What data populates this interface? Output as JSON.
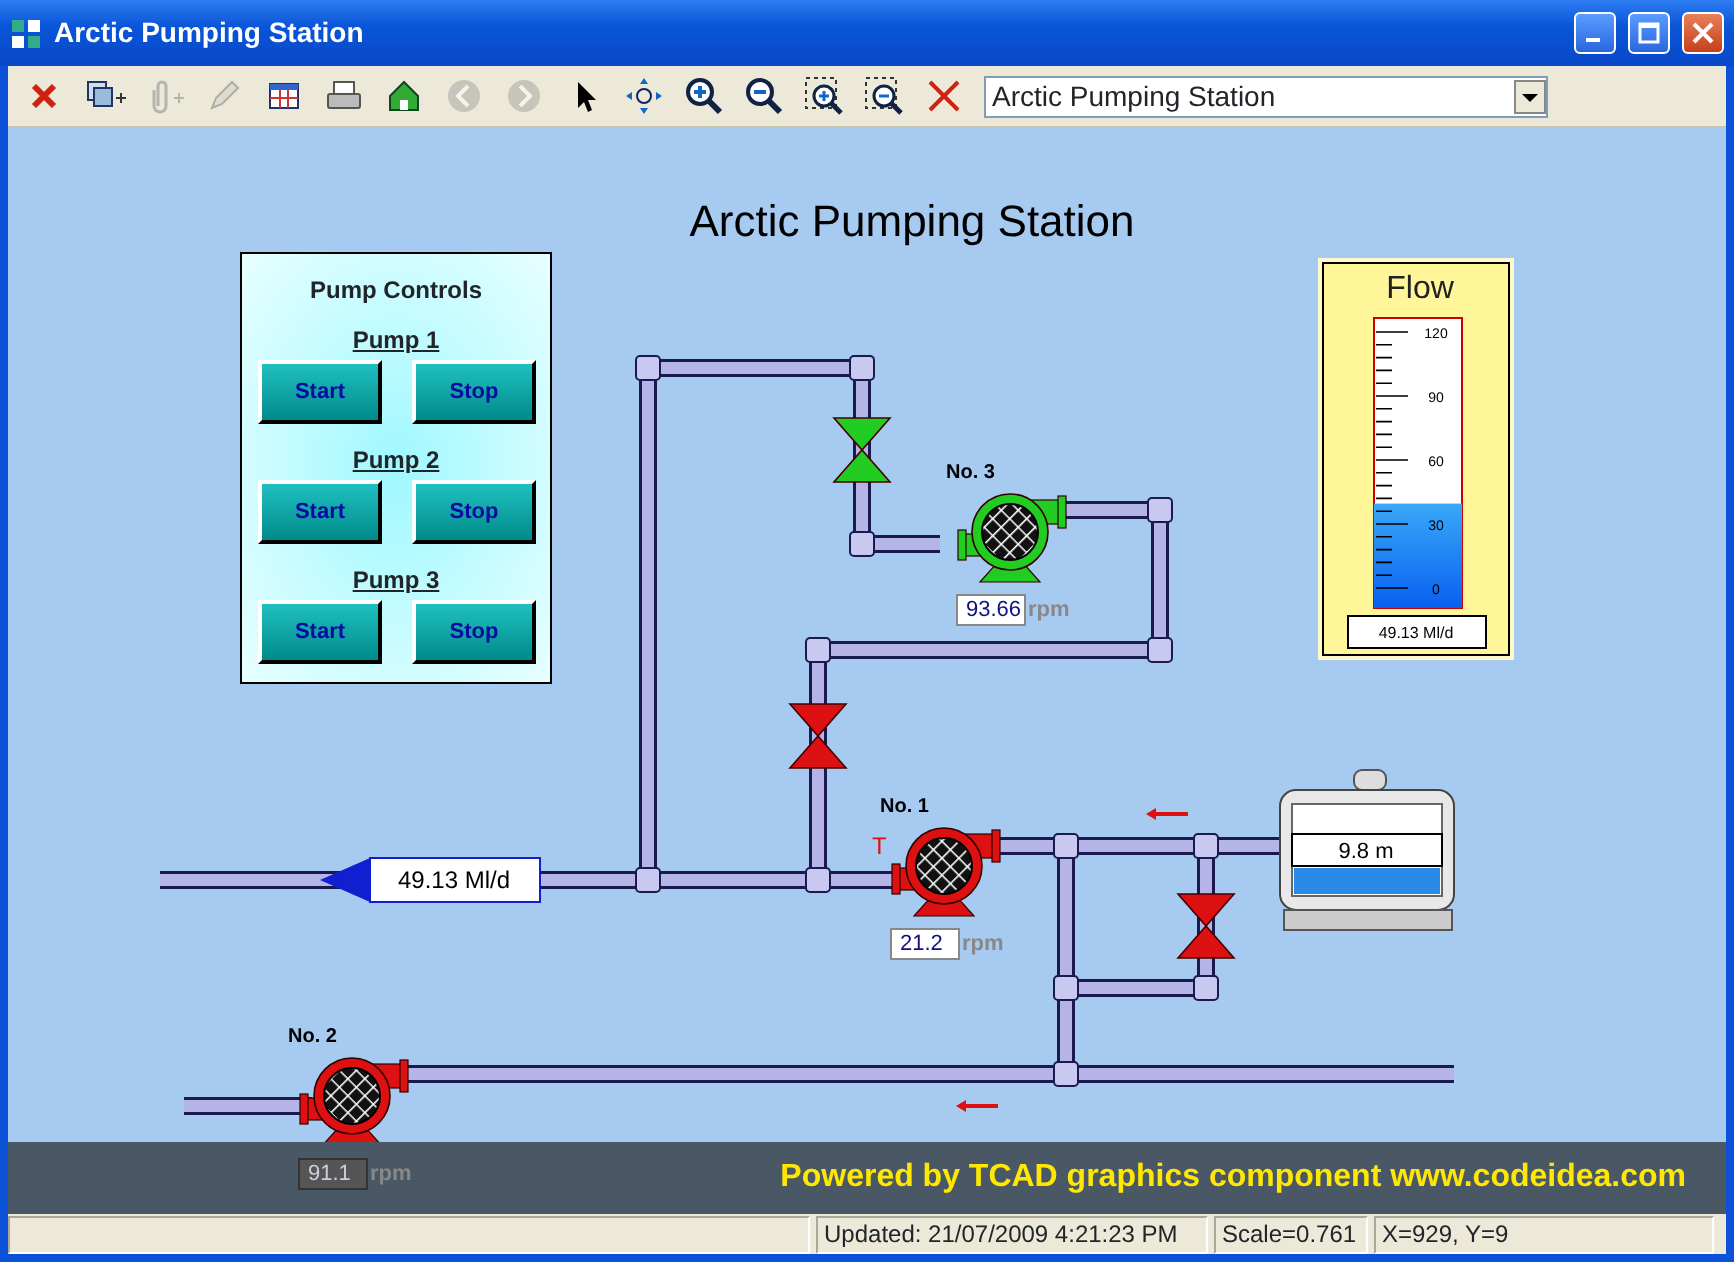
{
  "window": {
    "title": "Arctic Pumping Station"
  },
  "toolbar": [
    {
      "disabled": false
    },
    {
      "disabled": false
    },
    {
      "disabled": true
    },
    {
      "disabled": true
    },
    {
      "disabled": false
    },
    {
      "disabled": false
    },
    {
      "disabled": false
    },
    {
      "disabled": true
    },
    {
      "disabled": true
    },
    {
      "disabled": false
    },
    {
      "disabled": false
    },
    {
      "disabled": false
    },
    {
      "disabled": false
    },
    {
      "disabled": false
    },
    {
      "disabled": false
    },
    {
      "disabled": false
    }
  ],
  "view_selector": {
    "value": "Arctic Pumping Station"
  },
  "diagram": {
    "title": "Arctic Pumping Station",
    "pump_controls": {
      "title": "Pump Controls",
      "groups": [
        {
          "label": "Pump 1",
          "buttons": [
            "Start",
            "Stop"
          ]
        },
        {
          "label": "Pump 2",
          "buttons": [
            "Start",
            "Stop"
          ]
        },
        {
          "label": "Pump 3",
          "buttons": [
            "Start",
            "Stop"
          ]
        }
      ]
    },
    "flow_meter": {
      "title": "Flow",
      "scale": [
        "120",
        "90",
        "60",
        "30",
        "0"
      ],
      "level": 0.36,
      "reading": "49.13 Ml/d"
    },
    "pumps": [
      {
        "name": "No. 3",
        "rpm": "93.66",
        "unit": "rpm",
        "color": "#22cc22",
        "disabled": false
      },
      {
        "name": "No. 1",
        "rpm": "21.2",
        "unit": "rpm",
        "color": "#dd1111",
        "disabled": false,
        "alarm": "T"
      },
      {
        "name": "No. 2",
        "rpm": "91.1",
        "unit": "rpm",
        "color": "#dd1111",
        "disabled": true
      }
    ],
    "valves": [
      {
        "color": "#22cc22"
      },
      {
        "color": "#dd1111"
      },
      {
        "color": "#dd1111"
      }
    ],
    "outflow": {
      "reading": "49.13 Ml/d"
    },
    "tank": {
      "reading": "9.8 m"
    },
    "banner": "Powered by TCAD graphics component www.codeidea.com"
  },
  "status_bar": [
    "Updated: 21/07/2009 4:21:23 PM",
    "Scale=0.761",
    "X=929, Y=9"
  ]
}
